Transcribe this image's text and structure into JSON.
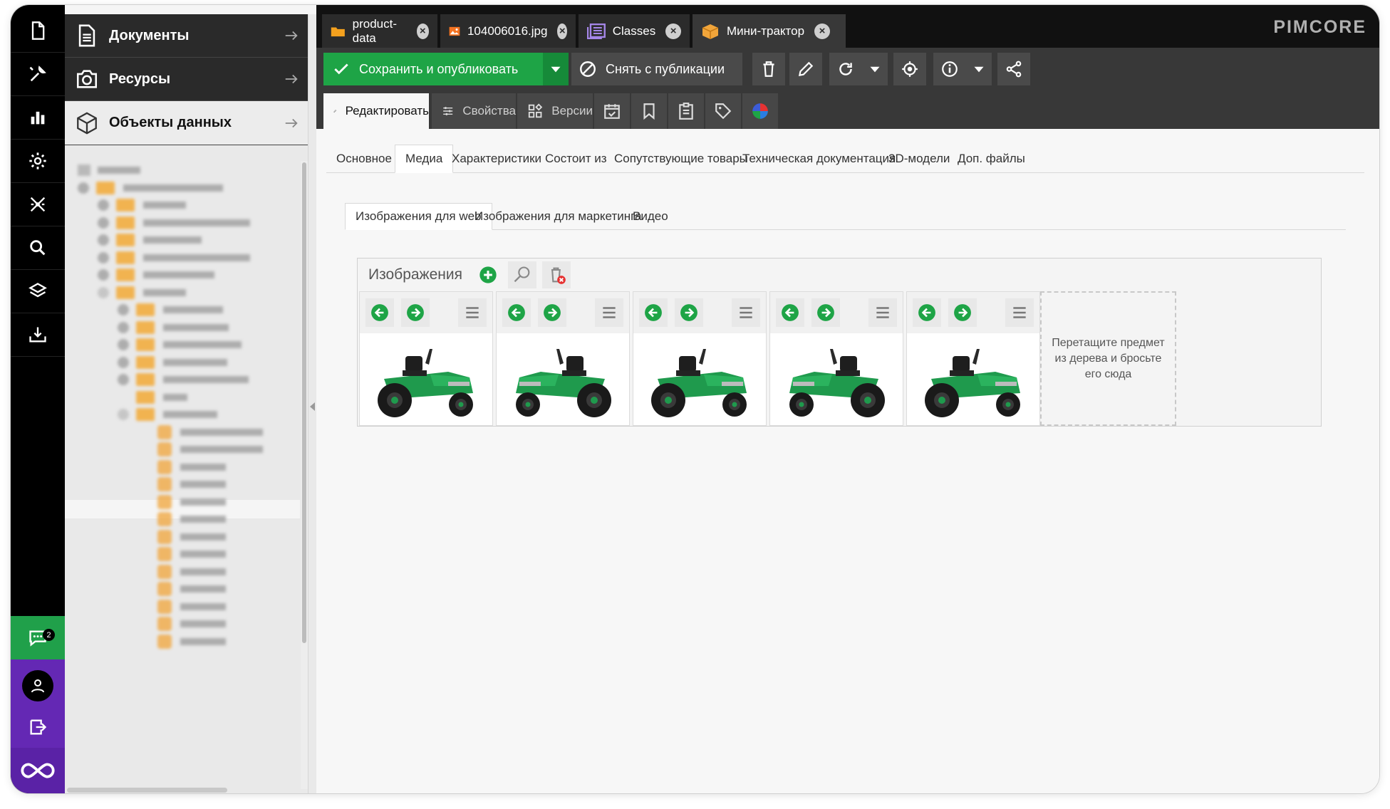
{
  "tree": {
    "documents_label": "Документы",
    "assets_label": "Ресурсы",
    "objects_label": "Объекты данных"
  },
  "tabs": [
    {
      "label": "product-data",
      "icon": "folder-icon"
    },
    {
      "label": "104006016.jpg",
      "icon": "image-icon"
    },
    {
      "label": "Classes",
      "icon": "classes-icon"
    },
    {
      "label": "Мини-трактор",
      "icon": "object-icon"
    }
  ],
  "brand": {
    "logo_text": "PIMCORE"
  },
  "toolbar": {
    "save_publish_label": "Сохранить и опубликовать",
    "unpublish_label": "Снять с публикации"
  },
  "view_tabs": {
    "edit_label": "Редактировать",
    "properties_label": "Свойства",
    "versions_label": "Версии"
  },
  "sub_tabs": [
    "Основное",
    "Медиа",
    "Характеристики",
    "Состоит из",
    "Сопутствующие товары",
    "Техническая документация",
    "3D-модели",
    "Доп. файлы"
  ],
  "media_tabs": [
    "Изображения для web",
    "Изображения для маркетинга",
    "Видео"
  ],
  "gallery": {
    "title": "Изображения",
    "drop_hint": "Перетащите предмет из дерева и бросьте его сюда",
    "tile_count": 5
  },
  "chat": {
    "badge_count": "2"
  },
  "colors": {
    "accent_green": "#1ea446",
    "purple": "#6428b4",
    "folder": "#f4a11e",
    "rail_bg": "#000000"
  }
}
